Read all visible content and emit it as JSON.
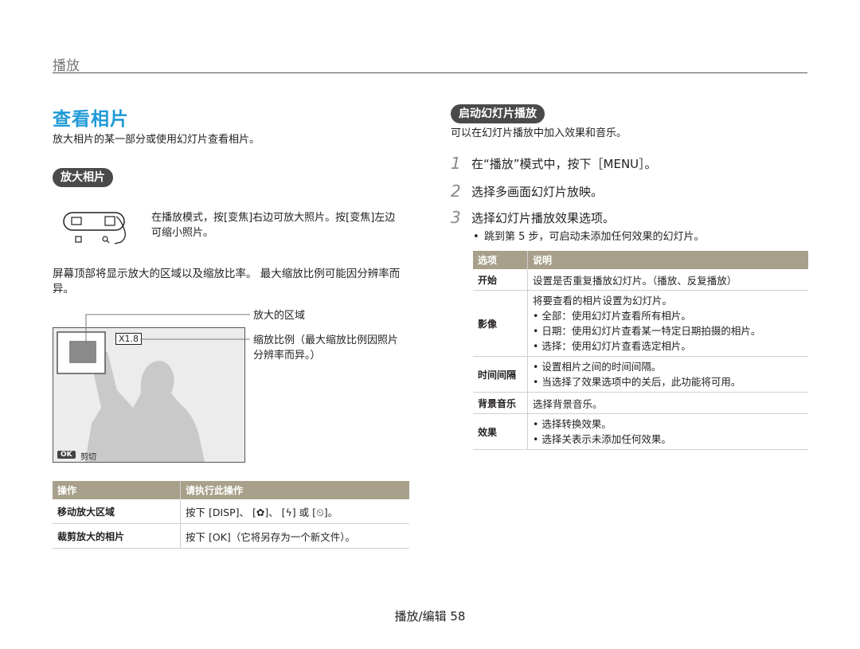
{
  "header": {
    "section": "播放",
    "page_title": "查看相片"
  },
  "left": {
    "intro": "放大相片的某一部分或使用幻灯片查看相片。",
    "zoom_pill": "放大相片",
    "zoom_instruction": "在播放模式，按[变焦]右边可放大照片。按[变焦]左边可缩小照片。",
    "zoom_note": "屏幕顶部将显示放大的区域以及缩放比率。 最大缩放比例可能因分辨率而异。",
    "callout_area": "放大的区域",
    "callout_ratio": "缩放比例（最大缩放比例因照片分辨率而异。）",
    "ratio_value": "X1.8",
    "ok_label": "OK",
    "crop_label": "剪切",
    "table": {
      "headers": [
        "操作",
        "请执行此操作"
      ],
      "rows": [
        {
          "op": "移动放大区域",
          "action": "按下 [DISP]、 [✿]、 [ϟ] 或 [⏲]。"
        },
        {
          "op": "裁剪放大的相片",
          "action": "按下 [OK]（它将另存为一个新文件）。"
        }
      ]
    }
  },
  "right": {
    "pill": "启动幻灯片播放",
    "intro": "可以在幻灯片播放中加入效果和音乐。",
    "steps": [
      {
        "num": "1",
        "text": "在“播放”模式中，按下［MENU］。"
      },
      {
        "num": "2",
        "text": "选择多画面幻灯片放映。"
      },
      {
        "num": "3",
        "text": "选择幻灯片播放效果选项。"
      }
    ],
    "step3_bullet": "跳到第 5 步，可启动未添加任何效果的幻灯片。",
    "table": {
      "headers": [
        "选项",
        "说明"
      ],
      "rows": [
        {
          "key": "开始",
          "lines": [
            "设置是否重复播放幻灯片。（播放、反复播放）"
          ]
        },
        {
          "key": "影像",
          "lines": [
            "将要查看的相片设置为幻灯片。",
            "• 全部：使用幻灯片查看所有相片。",
            "• 日期：使用幻灯片查看某一特定日期拍摄的相片。",
            "• 选择：使用幻灯片查看选定相片。"
          ]
        },
        {
          "key": "时间间隔",
          "lines": [
            "• 设置相片之间的时间间隔。",
            "• 当选择了效果选项中的关后，此功能将可用。"
          ]
        },
        {
          "key": "背景音乐",
          "lines": [
            "选择背景音乐。"
          ]
        },
        {
          "key": "效果",
          "lines": [
            "• 选择转换效果。",
            "• 选择关表示未添加任何效果。"
          ]
        }
      ]
    }
  },
  "footer": {
    "label": "播放/编辑",
    "page_number": "58"
  }
}
